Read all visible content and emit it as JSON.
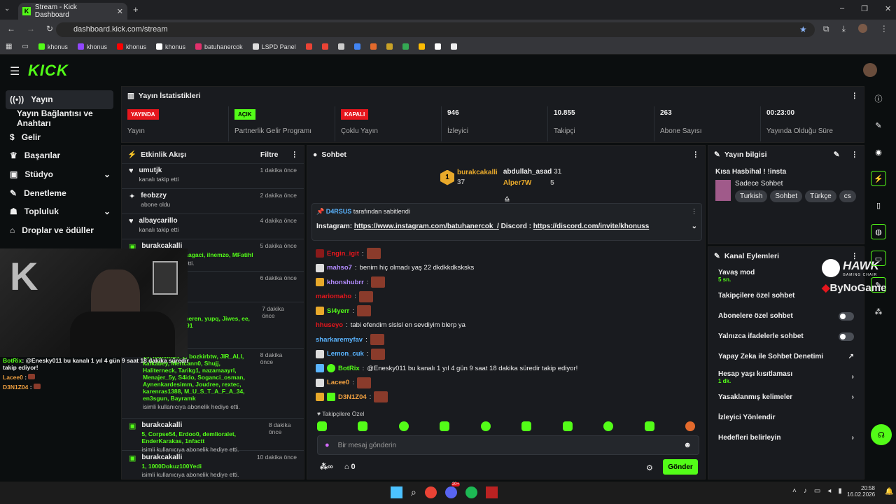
{
  "browser": {
    "tab_title": "Stream - Kick Dashboard",
    "url": "dashboard.kick.com/stream",
    "bookmarks": [
      "khonus",
      "khonus",
      "khonus",
      "khonus",
      "batuhanercok",
      "LSPD Panel"
    ]
  },
  "nav": {
    "items": [
      "Yayın",
      "Yayın Bağlantısı ve Anahtarı",
      "Gelir",
      "Başarılar",
      "Stüdyo",
      "Denetleme",
      "Topluluk",
      "Droplar ve ödüller"
    ]
  },
  "stats": {
    "title": "Yayın İstatistikleri",
    "items": [
      {
        "badge": "YAYINDA",
        "badge_color": "#e5161d",
        "label": "Yayın"
      },
      {
        "badge": "AÇIK",
        "badge_color": "#53fc18",
        "label": "Partnerlik Gelir Programı"
      },
      {
        "badge": "KAPALI",
        "badge_color": "#e5161d",
        "label": "Çoklu Yayın"
      },
      {
        "value": "946",
        "label": "İzleyici"
      },
      {
        "value": "10.855",
        "label": "Takipçi"
      },
      {
        "value": "263",
        "label": "Abone Sayısı"
      },
      {
        "value": "00:23:00",
        "label": "Yayında Olduğu Süre"
      }
    ]
  },
  "activity": {
    "title": "Etkinlik Akışı",
    "filter": "Filtre",
    "items": [
      {
        "name": "umutjk",
        "sub": "kanalı takip etti",
        "time": "1 dakika önce"
      },
      {
        "name": "feobzzy",
        "sub": "abone oldu",
        "time": "2 dakika önce"
      },
      {
        "name": "albaycarillo",
        "sub": "kanalı takip etti",
        "time": "4 dakika önce"
      },
      {
        "name": "burakcakalli",
        "sub": "",
        "time": "5 dakika önce"
      },
      {
        "name": "",
        "sub": "",
        "time": "6 dakika önce"
      },
      {
        "name": "",
        "sub": "",
        "time": "7 dakika önce"
      }
    ],
    "gift_lists": [
      "lt, opie0_0, Elmaagaci, ilnemzo, MFatihl",
      "ayto, Lacee0, Sevkaneren, yupq, Jiwes, ee, Taha_1905t, yigit_0291",
      "19, luminous_2, bozkirbtw, JIR_ALI, kafkabey, Mertcann0, Shujj, Haliterneck, Tarikg1, nazamaayrl, Menajer_5y, S4ido, Soganci_osman, Aynenkardesimm, Joudree, rextec, karenras1388, M_U_S_T_A_F_A_34, en3sgun, Bayramk"
    ],
    "gift_sub": "isimli kullanıcıya abonelik hediye etti.",
    "gift_sub2": "abonelik hediye etti.",
    "time8": "8 dakika önce",
    "bottom": [
      {
        "name": "burakcakalli",
        "time": "8 dakika önce",
        "list": "5, Corpse54, Erdoo0, demlioralet, EnderKarakas, 1nfactt",
        "sub": "isimli kullanıcıya abonelik hediye etti."
      },
      {
        "name": "burakcakalli",
        "time": "10 dakika önce",
        "list": "1, 1000Dokuz100Yedi",
        "sub": "isimli kullanıcıya abonelik hediye etti."
      }
    ]
  },
  "chat": {
    "title": "Sohbet",
    "top": [
      {
        "rank": "1",
        "name": "burakcakalli",
        "count": "37"
      },
      {
        "name": "abdullah_asad",
        "count": "31"
      },
      {
        "name": "Alper7W",
        "count": "5"
      }
    ],
    "pinned_by": "D4RSUS",
    "pinned_suffix": "tarafından sabitlendi",
    "pinned_prefix": "Instagram: ",
    "pinned_link1": "https://www.instagram.com/batuhanercok_/",
    "pinned_mid": " Discord : ",
    "pinned_link2": "https://discord.com/invite/khonuss",
    "messages": [
      {
        "user": "Engin_igit",
        "color": "#e5161d",
        "text": ""
      },
      {
        "user": "mahso7",
        "color": "#b38cff",
        "text": "benim hiç olmadı yaş 22 dkdkkdksksks"
      },
      {
        "user": "khonshubrr",
        "color": "#b38cff",
        "text": ""
      },
      {
        "user": "mariomaho",
        "color": "#e5161d",
        "text": ""
      },
      {
        "user": "Sl4yerr",
        "color": "#53fc18",
        "text": ""
      },
      {
        "user": "hhuseyo",
        "color": "#e5161d",
        "text": "tabi efendim slslsl en sevdiyim blerp ya"
      },
      {
        "user": "sharkaremyfav",
        "color": "#5ab4ff",
        "text": ""
      },
      {
        "user": "Lemon_cuk",
        "color": "#5ab4ff",
        "text": ""
      },
      {
        "user": "BotRix",
        "color": "#53fc18",
        "text": "@Enesky011 bu kanalı 1 yıl 4 gün 9 saat 18 dakika süredir takip ediyor!"
      },
      {
        "user": "Lacee0",
        "color": "#f0a040",
        "text": ""
      },
      {
        "user": "D3N1Z04",
        "color": "#f0a040",
        "text": ""
      }
    ],
    "followers_only": "Takipçilere Özel",
    "placeholder": "Bir mesaj gönderin",
    "send": "Gönder",
    "points": "0"
  },
  "info": {
    "title": "Yayın bilgisi",
    "stream_title": "Kısa Hasbihal ! !insta",
    "category": "Sadece Sohbet",
    "tags": [
      "Turkish",
      "Sohbet",
      "Türkçe",
      "cs"
    ]
  },
  "actions": {
    "title": "Kanal Eylemleri",
    "items": [
      {
        "label": "Yavaş mod",
        "sub": "5 sn.",
        "type": "none"
      },
      {
        "label": "Takipçilere özel sohbet",
        "sub": "",
        "type": "none"
      },
      {
        "label": "Abonelere özel sohbet",
        "sub": "",
        "type": "toggle"
      },
      {
        "label": "Yalnızca ifadelerle sohbet",
        "sub": "",
        "type": "toggle"
      },
      {
        "label": "Yapay Zeka ile Sohbet Denetimi",
        "sub": "",
        "type": "ext"
      },
      {
        "label": "Hesap yaşı kısıtlaması",
        "sub": "1 dk.",
        "type": "arrow"
      },
      {
        "label": "Yasaklanmış kelimeler",
        "sub": "",
        "type": "arrow"
      },
      {
        "label": "İzleyici Yönlendir",
        "sub": "",
        "type": "none"
      },
      {
        "label": "Hedefleri belirleyin",
        "sub": "",
        "type": "arrow"
      }
    ]
  },
  "overlay": {
    "msg1_user": "BotRix",
    "msg1_text": "@Enesky011 bu kanalı 1 yıl 4 gün 9 saat 18 dakika süredir takip ediyor!",
    "msg2_user": "Lacee0",
    "msg3_user": "D3N1Z04",
    "hawk": "HAWK",
    "hawk_sub": "GAMING CHAIR",
    "bynogame": "ByNoGame"
  },
  "taskbar": {
    "time": "20:58",
    "date": "16.02.2026",
    "badge": "20+"
  },
  "colors": {
    "accent": "#53fc18",
    "live": "#e5161d",
    "panel": "#191b1f"
  }
}
